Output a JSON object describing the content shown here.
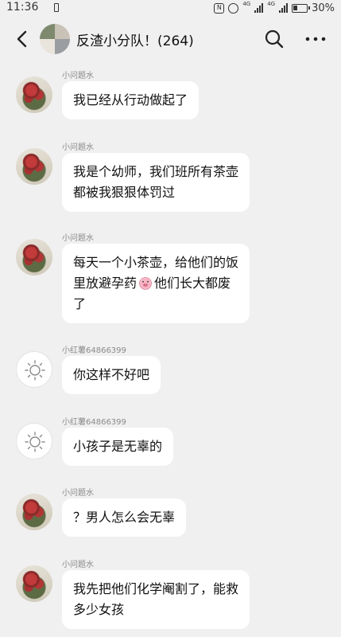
{
  "status_bar": {
    "time": "11:36",
    "battery": "30%",
    "nfc": "N",
    "signal_label_1": "4G",
    "signal_label_2": "4G"
  },
  "header": {
    "title": "反渣小分队！(264)"
  },
  "messages": [
    {
      "sender": "小问题水",
      "avatar": "rose-avatar",
      "text": "我已经从行动做起了"
    },
    {
      "sender": "小问题水",
      "avatar": "rose-avatar",
      "text": "我是个幼师，我们班所有茶壶\n都被我狠狠体罚过"
    },
    {
      "sender": "小问题水",
      "avatar": "rose-avatar",
      "text_before_emoji": "每天一个小茶壶，给他们的饭\n里放避孕药",
      "emoji": "pig-face-emoji",
      "text_after_emoji": "他们长大都废\n了"
    },
    {
      "sender": "小红薯64866399",
      "avatar": "sun-avatar",
      "text": "你这样不好吧"
    },
    {
      "sender": "小红薯64866399",
      "avatar": "sun-avatar",
      "text": "小孩子是无辜的"
    },
    {
      "sender": "小问题水",
      "avatar": "rose-avatar",
      "text": "？男人怎么会无辜"
    },
    {
      "sender": "小问题水",
      "avatar": "rose-avatar",
      "text": "我先把他们化学阉割了，能救\n多少女孩"
    }
  ]
}
